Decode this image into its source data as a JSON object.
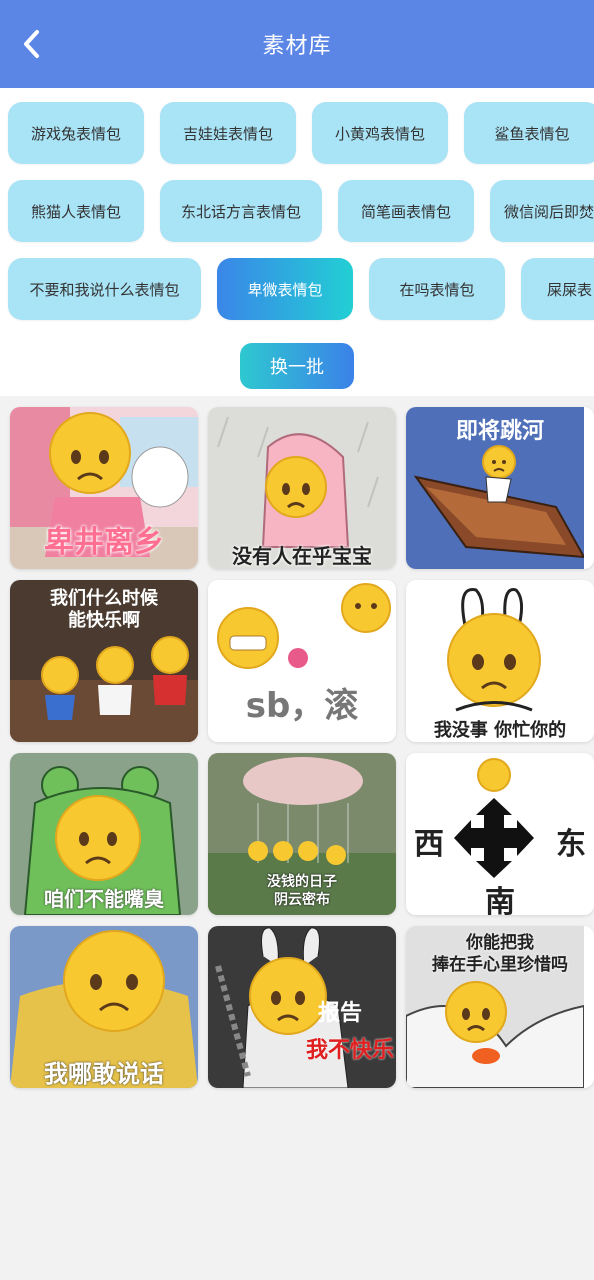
{
  "header": {
    "title": "素材库"
  },
  "tags": {
    "row1": [
      "游戏兔表情包",
      "吉娃娃表情包",
      "小黄鸡表情包",
      "鲨鱼表情包"
    ],
    "row2": [
      "熊猫人表情包",
      "东北话方言表情包",
      "简笔画表情包",
      "微信阅后即焚"
    ],
    "row3": [
      "不要和我说什么表情包",
      "卑微表情包",
      "在吗表情包",
      "屎屎表"
    ]
  },
  "selected_tag": "卑微表情包",
  "shuffle_label": "换一批",
  "stickers": [
    {
      "caption": "卑井离乡"
    },
    {
      "caption": "没有人在乎宝宝"
    },
    {
      "caption": "即将跳河"
    },
    {
      "caption_line1": "我们什么时候",
      "caption_line2": "能快乐啊"
    },
    {
      "caption": "sb，滚"
    },
    {
      "caption": "我没事 你忙你的"
    },
    {
      "caption": "咱们不能嘴臭"
    },
    {
      "caption_line1": "没钱的日子",
      "caption_line2": "阴云密布"
    },
    {
      "west": "西",
      "east": "东",
      "south": "南"
    },
    {
      "caption": "我哪敢说话"
    },
    {
      "caption_line1": "报告",
      "caption_line2": "我不快乐"
    },
    {
      "caption_line1": "你能把我",
      "caption_line2": "捧在手心里珍惜吗"
    }
  ],
  "colors": {
    "header": "#5b86e5",
    "chip": "#a9e3f6",
    "accent_start": "#3a86e8",
    "accent_end": "#22cfd4",
    "emoji": "#f7c830"
  }
}
